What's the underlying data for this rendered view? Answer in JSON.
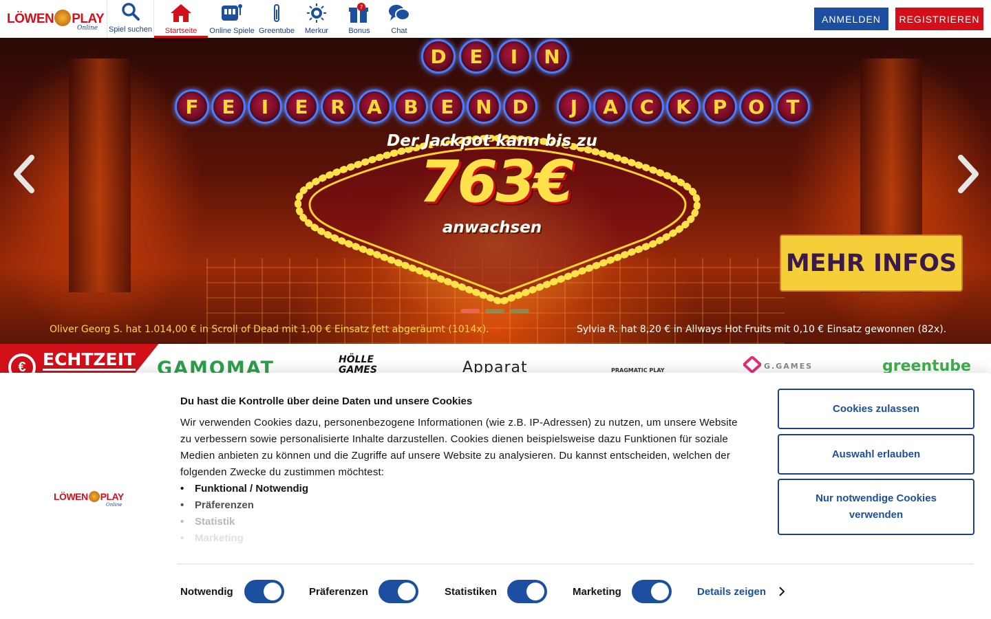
{
  "header": {
    "logo_text": "LÖWEN",
    "logo_text2": "PLAY",
    "logo_sub": "Online",
    "nav": [
      {
        "label": "Spiel suchen",
        "icon": "search-icon"
      },
      {
        "label": "Startseite",
        "icon": "home-icon",
        "active": true
      },
      {
        "label": "Online Spiele",
        "icon": "slot-machine-icon"
      },
      {
        "label": "Greentube",
        "icon": "greentube-icon"
      },
      {
        "label": "Merkur",
        "icon": "merkur-sun-icon"
      },
      {
        "label": "Bonus",
        "icon": "gift-icon"
      },
      {
        "label": "Chat",
        "icon": "chat-icon"
      }
    ],
    "login_label": "ANMELDEN",
    "register_label": "REGISTRIEREN"
  },
  "hero": {
    "headline_word1": "DEIN",
    "headline_word2": "FEIERABEND",
    "headline_word3": "JACKPOT",
    "subline": "Der Jackpot kann bis zu",
    "amount": "763€",
    "suffix": "anwachsen",
    "cta_label": "MEHR INFOS",
    "slides": 3,
    "active_slide": 1,
    "ticker_left": "Oliver Georg S. hat 1.014,00 € in Scroll of Dead mit 1,00 € Einsatz fett abgeräumt (1014x).",
    "ticker_right": "Sylvia R. hat 8,20 € in Allways Hot Fruits mit 0,10 € Einsatz gewonnen (82x)."
  },
  "providers": {
    "echtzeit_label": "ECHTZEIT",
    "echtzeit_symbol": "€",
    "items": [
      "GAMOMAT",
      "HÖLLE GAMES",
      "Apparat",
      "PRAGMATIC PLAY",
      "G.GAMES",
      "greentube"
    ]
  },
  "cookies": {
    "logo_text": "LÖWEN",
    "logo_text2": "PLAY",
    "logo_sub": "Online",
    "title": "Du hast die Kontrolle über deine Daten und unsere Cookies",
    "body": "Wir verwenden Cookies dazu, personenbezogene Informationen (wie z.B. IP-Adressen) zu nutzen, um unsere Website zu verbessern sowie personalisierte Inhalte darzustellen. Cookies dienen beispielsweise dazu Funktionen für soziale Medien anbieten zu können und die Zugriffe auf unsere Website zu analysieren. Du kannst entscheiden, welchen der folgenden Zwecke du zustimmen möchtest:",
    "purposes": [
      "Funktional / Notwendig",
      "Präferenzen",
      "Statistik",
      "Marketing"
    ],
    "allow_all_label": "Cookies zulassen",
    "allow_selection_label": "Auswahl erlauben",
    "necessary_only_label": "Nur notwendige Cookies verwenden",
    "toggles": [
      {
        "label": "Notwendig",
        "on": true
      },
      {
        "label": "Präferenzen",
        "on": true
      },
      {
        "label": "Statistiken",
        "on": true
      },
      {
        "label": "Marketing",
        "on": true
      }
    ],
    "details_label": "Details zeigen"
  },
  "colors": {
    "brand_red": "#d3101a",
    "brand_blue": "#1c4fa0",
    "cta_yellow": "#f4cf3a"
  }
}
